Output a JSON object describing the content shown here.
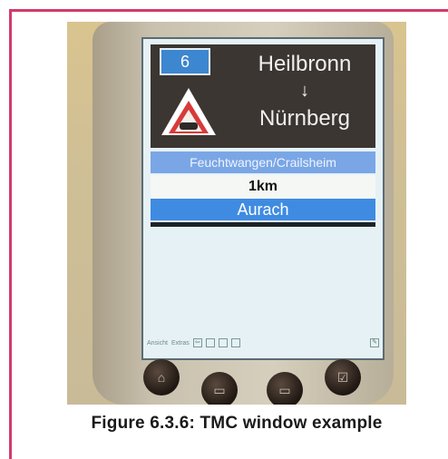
{
  "sign": {
    "road_number": "6",
    "from": "Heilbronn",
    "arrow": "↓",
    "to": "Nürnberg"
  },
  "via": "Feuchtwangen/Crailsheim",
  "distance": "1km",
  "place": "Aurach",
  "taskbar": {
    "menu_ansicht": "Ansicht",
    "menu_extras": "Extras"
  },
  "caption": "Figure 6.3.6: TMC window example",
  "colors": {
    "frame_accent": "#d23a6a",
    "sign_background": "#3b3631",
    "highlight_blue": "#3f8be2",
    "via_blue": "#7aa6e6"
  },
  "icons": [
    "warning-triangle-icon",
    "down-arrow-icon",
    "document-icon",
    "folder-icon",
    "pen-icon"
  ]
}
